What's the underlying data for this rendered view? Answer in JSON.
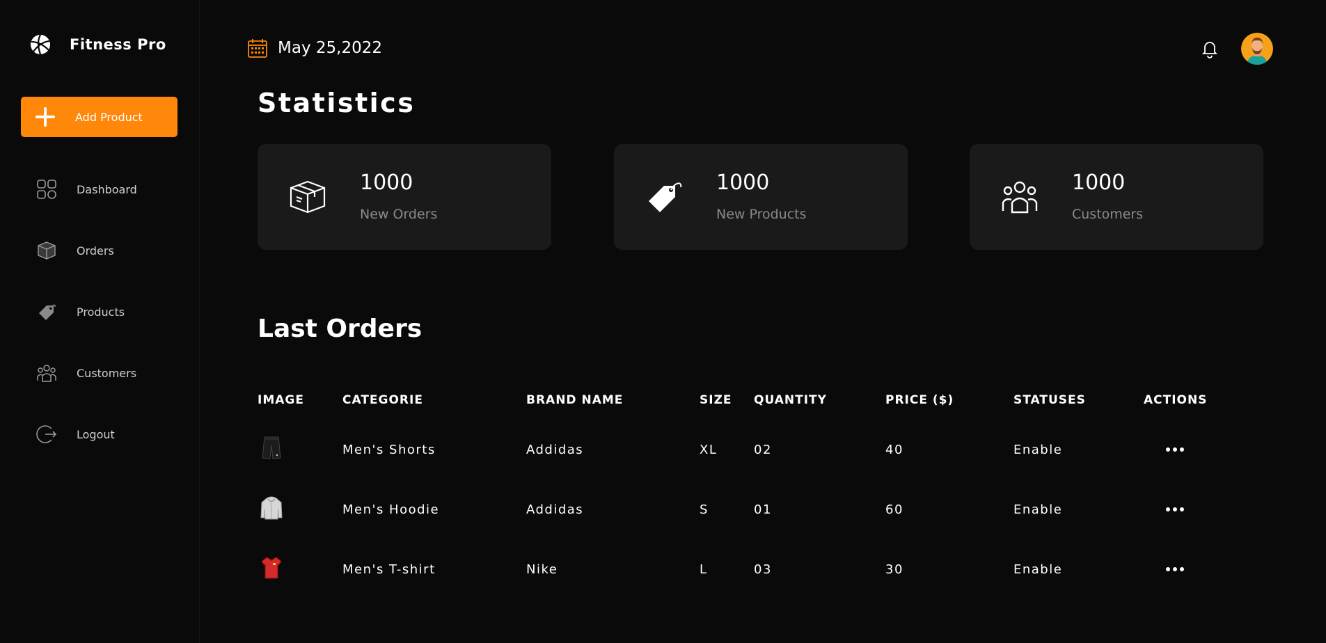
{
  "brand": {
    "name": "Fitness Pro"
  },
  "accent_color": "#ff870a",
  "sidebar": {
    "add_button_label": "Add Product",
    "items": [
      {
        "label": "Dashboard",
        "icon": "grid-icon"
      },
      {
        "label": "Orders",
        "icon": "box-icon"
      },
      {
        "label": "Products",
        "icon": "tag-icon"
      },
      {
        "label": "Customers",
        "icon": "users-icon"
      },
      {
        "label": "Logout",
        "icon": "logout-icon"
      }
    ]
  },
  "topbar": {
    "date": "May 25,2022"
  },
  "stats": {
    "title": "Statistics",
    "cards": [
      {
        "value": "1000",
        "label": "New Orders",
        "icon": "box-icon"
      },
      {
        "value": "1000",
        "label": "New Products",
        "icon": "tag-icon"
      },
      {
        "value": "1000",
        "label": "Customers",
        "icon": "users-icon"
      }
    ]
  },
  "orders": {
    "title": "Last Orders",
    "columns": [
      "IMAGE",
      "CATEGORIE",
      "BRAND NAME",
      "SIZE",
      "QUANTITY",
      "PRICE ($)",
      "STATUSES",
      "ACTIONS"
    ],
    "rows": [
      {
        "image": "shorts-thumbnail",
        "category": "Men's Shorts",
        "brand": "Addidas",
        "size": "XL",
        "quantity": "02",
        "price": "40",
        "status": "Enable"
      },
      {
        "image": "hoodie-thumbnail",
        "category": "Men's Hoodie",
        "brand": "Addidas",
        "size": "S",
        "quantity": "01",
        "price": "60",
        "status": "Enable"
      },
      {
        "image": "tshirt-thumbnail",
        "category": "Men's T-shirt",
        "brand": "Nike",
        "size": "L",
        "quantity": "03",
        "price": "30",
        "status": "Enable"
      }
    ]
  }
}
